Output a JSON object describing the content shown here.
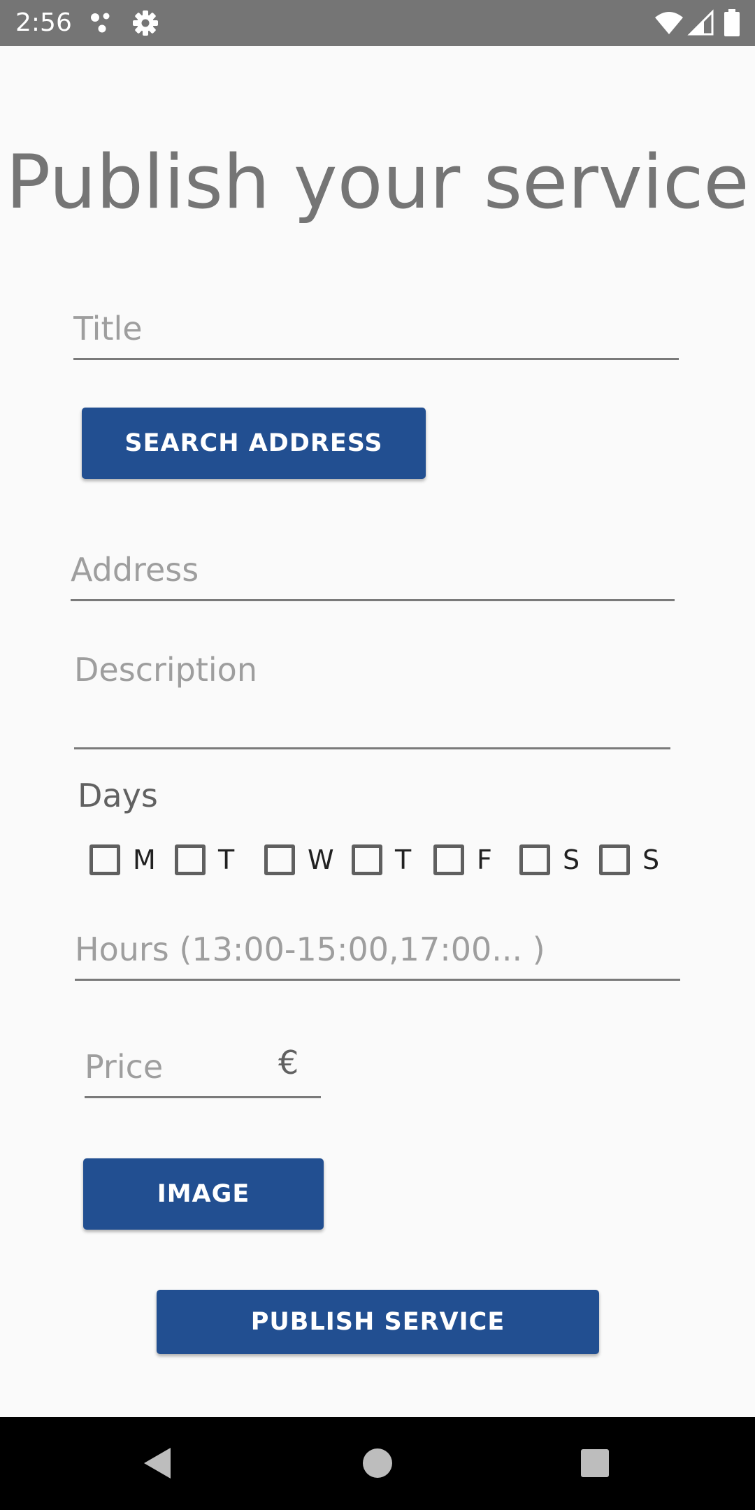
{
  "status_bar": {
    "time": "2:56",
    "icons": [
      "notification-dots-icon",
      "settings-gear-icon",
      "wifi-icon",
      "cellular-signal-icon",
      "battery-icon"
    ],
    "color": "#757575"
  },
  "page": {
    "title": "Publish your service"
  },
  "form": {
    "title_placeholder": "Title",
    "search_address_label": "SEARCH ADDRESS",
    "address_placeholder": "Address",
    "description_placeholder": "Description",
    "days_label": "Days",
    "days": [
      {
        "label": "M",
        "checked": false
      },
      {
        "label": "T",
        "checked": false
      },
      {
        "label": "W",
        "checked": false
      },
      {
        "label": "T",
        "checked": false
      },
      {
        "label": "F",
        "checked": false
      },
      {
        "label": "S",
        "checked": false
      },
      {
        "label": "S",
        "checked": false
      }
    ],
    "hours_placeholder": "Hours (13:00-15:00,17:00... )",
    "price_placeholder": "Price",
    "currency_symbol": "€",
    "image_button_label": "IMAGE",
    "publish_button_label": "PUBLISH SERVICE"
  },
  "nav_bar": {
    "icons": [
      "back-icon",
      "home-icon",
      "recents-icon"
    ]
  },
  "colors": {
    "primary_button": "#224f91",
    "background": "#fafafa",
    "title_text": "#757575"
  }
}
